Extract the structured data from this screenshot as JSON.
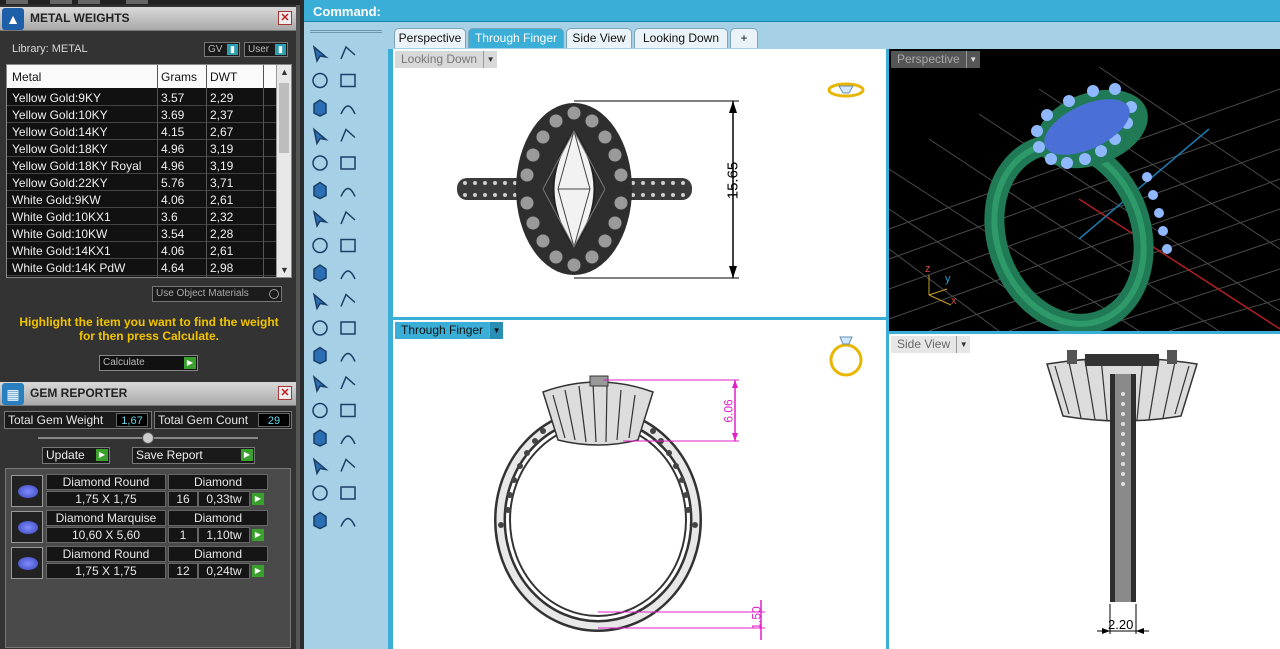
{
  "command": {
    "label": "Command:"
  },
  "metal_weights": {
    "title": "METAL WEIGHTS",
    "library_label": "Library: METAL",
    "gv_label": "GV",
    "user_label": "User",
    "columns": [
      "Metal",
      "Grams",
      "DWT"
    ],
    "rows": [
      [
        "Yellow Gold:9KY",
        "3.57",
        "2,29"
      ],
      [
        "Yellow Gold:10KY",
        "3.69",
        "2,37"
      ],
      [
        "Yellow Gold:14KY",
        "4.15",
        "2,67"
      ],
      [
        "Yellow Gold:18KY",
        "4.96",
        "3,19"
      ],
      [
        "Yellow Gold:18KY Royal",
        "4.96",
        "3,19"
      ],
      [
        "Yellow Gold:22KY",
        "5.76",
        "3,71"
      ],
      [
        "White Gold:9KW",
        "4.06",
        "2,61"
      ],
      [
        "White Gold:10KX1",
        "3.6",
        "2,32"
      ],
      [
        "White Gold:10KW",
        "3.54",
        "2,28"
      ],
      [
        "White Gold:14KX1",
        "4.06",
        "2,61"
      ],
      [
        "White Gold:14K PdW",
        "4.64",
        "2,98"
      ]
    ],
    "use_object_materials": "Use Object Materials",
    "hint": "Highlight the item you want to find the weight for then press Calculate.",
    "calculate_label": "Calculate"
  },
  "gem_reporter": {
    "title": "GEM REPORTER",
    "total_weight_label": "Total Gem Weight",
    "total_weight_value": "1,67",
    "total_count_label": "Total Gem Count",
    "total_count_value": "29",
    "update_label": "Update",
    "save_report_label": "Save Report",
    "gems": [
      {
        "shape": "Diamond Round",
        "material": "Diamond",
        "size": "1,75 X 1,75",
        "count": "16",
        "weight": "0,33tw"
      },
      {
        "shape": "Diamond Marquise",
        "material": "Diamond",
        "size": "10,60 X 5,60",
        "count": "1",
        "weight": "1,10tw"
      },
      {
        "shape": "Diamond Round",
        "material": "Diamond",
        "size": "1,75 X 1,75",
        "count": "12",
        "weight": "0,24tw"
      }
    ]
  },
  "tabs": [
    "Perspective",
    "Through Finger",
    "Side View",
    "Looking Down",
    "+"
  ],
  "viewports": {
    "looking_down": {
      "label": "Looking Down",
      "dimension": "15.65"
    },
    "perspective": {
      "label": "Perspective",
      "axis_z": "z",
      "axis_y": "y",
      "axis_x": "x"
    },
    "through_finger": {
      "label": "Through Finger",
      "dim_top": "6.06",
      "dim_bottom": "1.50"
    },
    "side_view": {
      "label": "Side View",
      "dimension": "2.20"
    }
  },
  "tool_icons": [
    "select-arrow-icon",
    "point-icon",
    "polyline-icon",
    "curve-point-icon",
    "circle-icon",
    "ellipse-icon",
    "polygon-icon",
    "rectangle-icon",
    "arc-icon",
    "fillet-curve-icon",
    "surface-pt-icon",
    "extrude-surface-icon",
    "box-solid-icon",
    "sphere-solid-icon",
    "cylinder-icon",
    "plane-icon",
    "boolean-explode-icon",
    "fire-icon",
    "transform-icon",
    "align-icon",
    "gem-cluster-icon",
    "gem-array-icon",
    "curve-pipe-icon",
    "offset-curve-icon",
    "text-icon",
    "scale-icon",
    "group-icon",
    "mirror-icon",
    "solid-box-edit-icon",
    "dim-linear-icon",
    "array-grid-icon",
    "render-icon",
    "cut-icon",
    "check-icon",
    "material-icon",
    "paint-icon"
  ],
  "colors": {
    "accent": "#3aaed6",
    "toolbar_bg": "#a6d0e5",
    "hint_yellow": "#f2c500",
    "dim_magenta": "#e020c8",
    "ring_green": "#1f7a55",
    "stone_blue": "#4a6fd6"
  }
}
